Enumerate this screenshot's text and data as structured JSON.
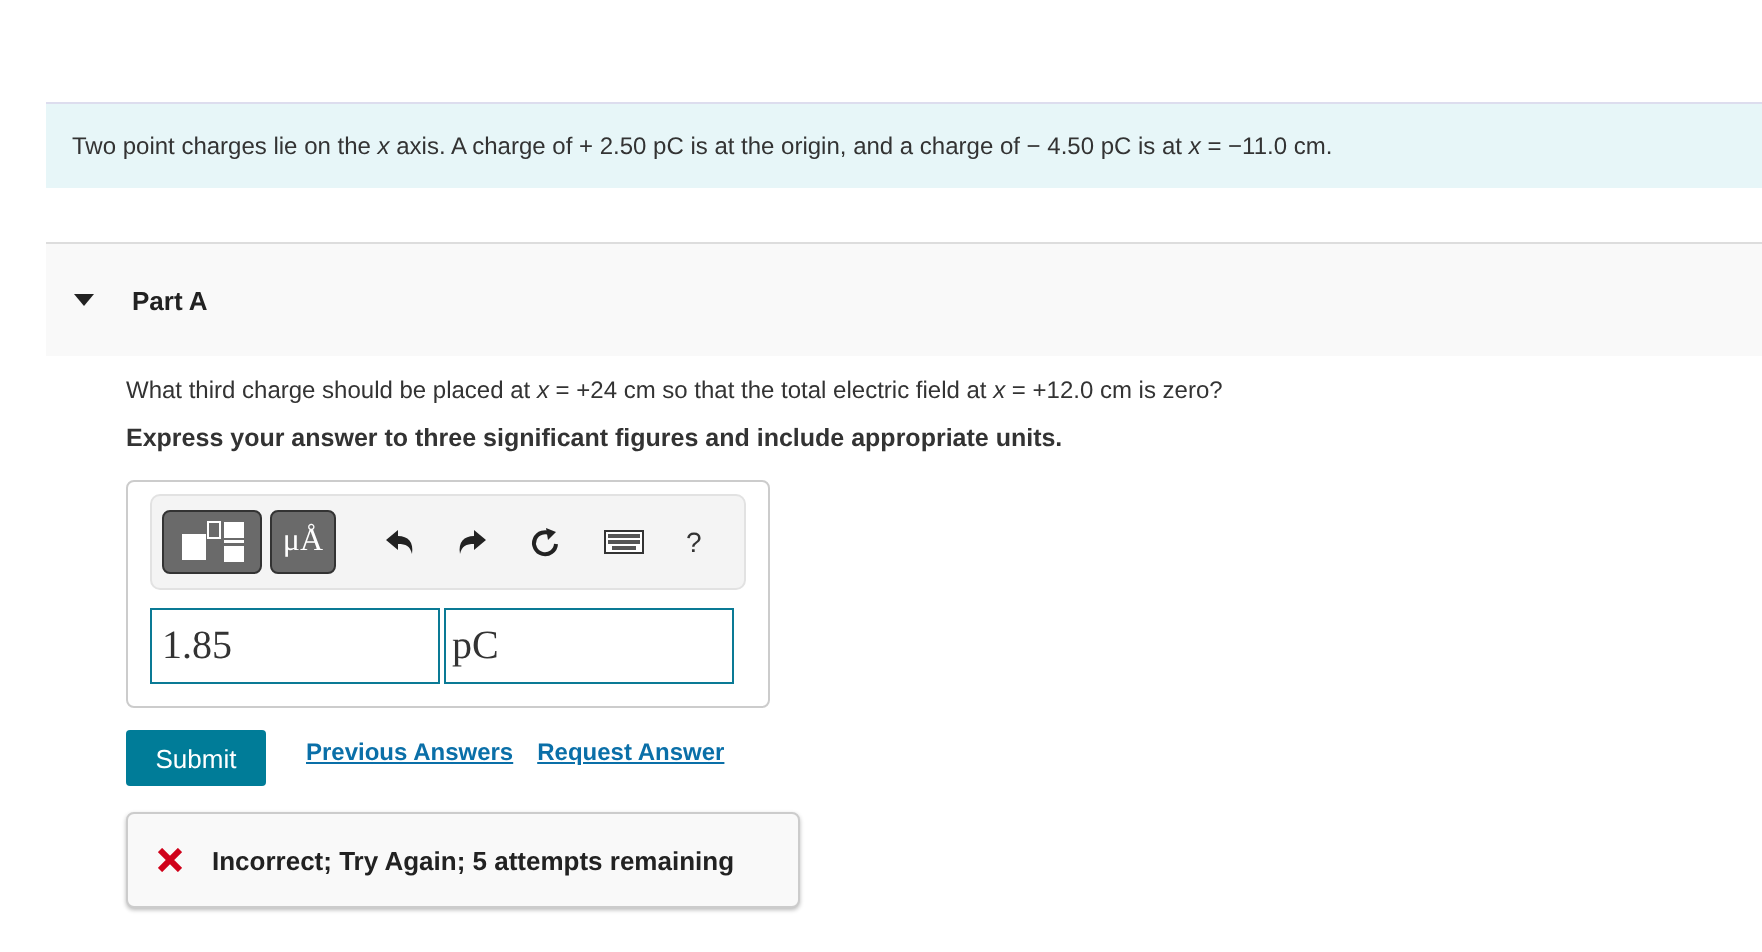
{
  "problem": {
    "text": "Two point charges lie on the *x* axis. A charge of + 2.50 pC is at the origin, and a charge of − 4.50 pC is at *x* = −11.0 cm."
  },
  "part": {
    "title": "Part A",
    "expanded": true,
    "question": "What third charge should be placed at *x* = +24 cm so that the total electric field at *x* = +12.0 cm is zero?",
    "instruction": "Express your answer to three significant figures and include appropriate units.",
    "toolbar": [
      {
        "kind": "templates"
      },
      {
        "kind": "units",
        "label": "μÅ"
      },
      {
        "kind": "undo"
      },
      {
        "kind": "redo"
      },
      {
        "kind": "reset"
      },
      {
        "kind": "keyboard"
      },
      {
        "kind": "help",
        "label": "?"
      }
    ],
    "value": "1.85",
    "units": "pC",
    "submit": "Submit",
    "links": [
      "Previous Answers",
      "Request Answer"
    ],
    "feedback": {
      "correct": false,
      "text": "Incorrect; Try Again; 5 attempts remaining"
    }
  }
}
